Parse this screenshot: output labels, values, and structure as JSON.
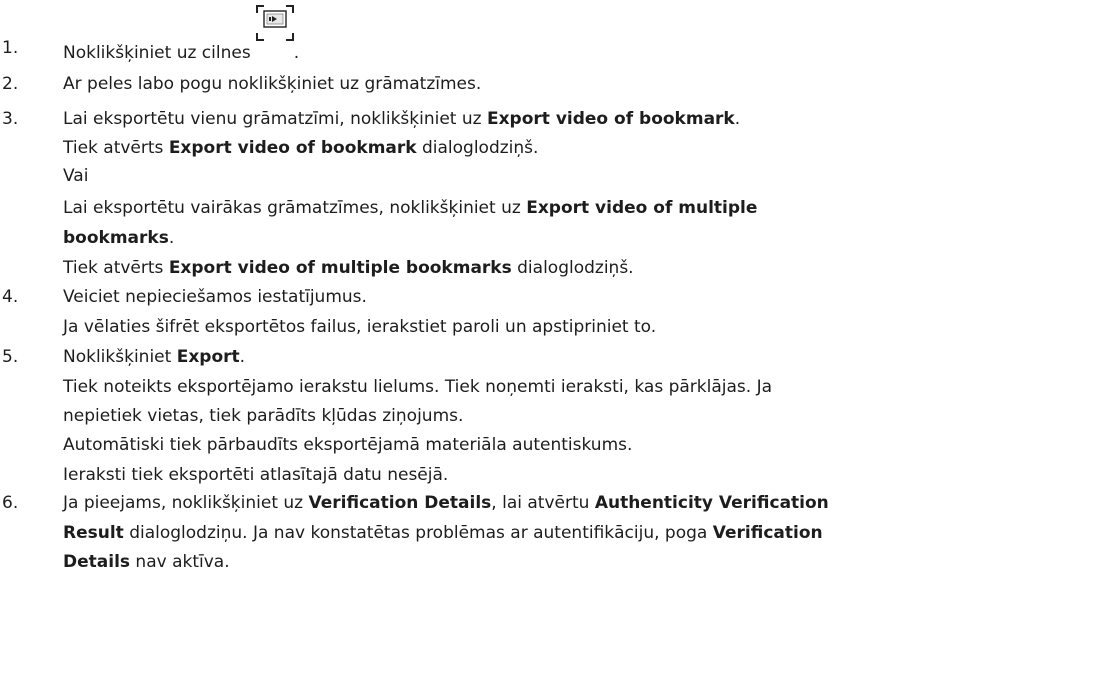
{
  "steps": [
    {
      "num": "1.",
      "lines": [
        {
          "parts": [
            {
              "t": "Noklikšķiniet uz cilnes"
            },
            {
              "icon": "tab-icon"
            },
            {
              "t": "."
            }
          ]
        }
      ]
    },
    {
      "num": "2.",
      "lines": [
        {
          "parts": [
            {
              "t": "Ar peles labo pogu noklikšķiniet uz grāmatzīmes."
            }
          ]
        }
      ]
    },
    {
      "num": "3.",
      "lines": [
        {
          "parts": [
            {
              "t": "Lai eksportētu vienu grāmatzīmi, noklikšķiniet uz "
            },
            {
              "t": "Export video of bookmark",
              "b": true
            },
            {
              "t": "."
            }
          ]
        },
        {
          "parts": [
            {
              "t": "Tiek atvērts "
            },
            {
              "t": "Export video of bookmark",
              "b": true
            },
            {
              "t": " dialoglodziņš."
            }
          ]
        },
        {
          "parts": [
            {
              "t": "Vai"
            }
          ]
        },
        {
          "parts": [
            {
              "t": "Lai eksportētu vairākas grāmatzīmes, noklikšķiniet uz "
            },
            {
              "t": "Export video of multiple",
              "b": true
            }
          ]
        },
        {
          "parts": [
            {
              "t": "bookmarks",
              "b": true
            },
            {
              "t": "."
            }
          ]
        },
        {
          "parts": [
            {
              "t": "Tiek atvērts "
            },
            {
              "t": "Export video of multiple bookmarks",
              "b": true
            },
            {
              "t": " dialoglodziņš."
            }
          ]
        }
      ]
    },
    {
      "num": "4.",
      "lines": [
        {
          "parts": [
            {
              "t": "Veiciet nepieciešamos iestatījumus."
            }
          ]
        },
        {
          "parts": [
            {
              "t": "Ja vēlaties šifrēt eksportētos failus, ierakstiet paroli un apstipriniet to."
            }
          ]
        }
      ]
    },
    {
      "num": "5.",
      "lines": [
        {
          "parts": [
            {
              "t": "Noklikšķiniet "
            },
            {
              "t": "Export",
              "b": true
            },
            {
              "t": "."
            }
          ]
        },
        {
          "parts": [
            {
              "t": "Tiek noteikts eksportējamo ierakstu lielums. Tiek noņemti ieraksti, kas pārklājas. Ja"
            }
          ]
        },
        {
          "parts": [
            {
              "t": "nepietiek vietas, tiek parādīts kļūdas ziņojums."
            }
          ]
        },
        {
          "parts": [
            {
              "t": "Automātiski tiek pārbaudīts eksportējamā materiāla autentiskums."
            }
          ]
        },
        {
          "parts": [
            {
              "t": "Ieraksti tiek eksportēti atlasītajā datu nesējā."
            }
          ]
        }
      ]
    },
    {
      "num": "6.",
      "lines": [
        {
          "parts": [
            {
              "t": "Ja pieejams, noklikšķiniet uz "
            },
            {
              "t": "Verification Details",
              "b": true
            },
            {
              "t": ", lai atvērtu "
            },
            {
              "t": "Authenticity Verification",
              "b": true
            }
          ]
        },
        {
          "parts": [
            {
              "t": "Result",
              "b": true
            },
            {
              "t": " dialoglodziņu. Ja nav konstatētas problēmas ar autentifikāciju, poga "
            },
            {
              "t": "Verification",
              "b": true
            }
          ]
        },
        {
          "parts": [
            {
              "t": "Details",
              "b": true
            },
            {
              "t": " nav aktīva."
            }
          ]
        }
      ]
    }
  ]
}
